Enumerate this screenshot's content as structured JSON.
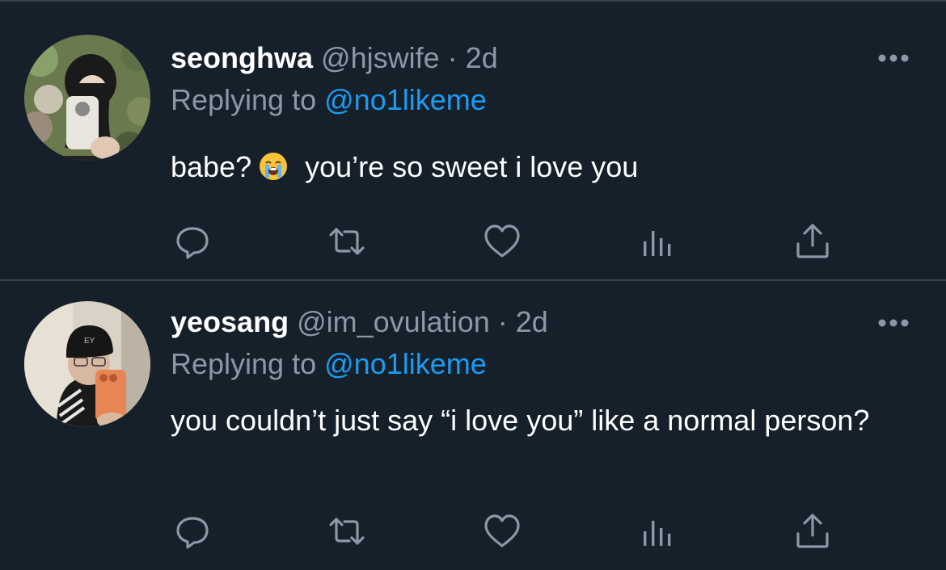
{
  "tweets": [
    {
      "display_name": "seonghwa",
      "handle": "@hjswife",
      "separator": "·",
      "time": "2d",
      "replying_prefix": "Replying to",
      "replying_to": "@no1likeme",
      "text_before_emoji": "babe?",
      "emoji": "loudly-crying-face",
      "text_after_emoji": "you’re so sweet i love you"
    },
    {
      "display_name": "yeosang",
      "handle": "@im_ovulation",
      "separator": "·",
      "time": "2d",
      "replying_prefix": "Replying to",
      "replying_to": "@no1likeme",
      "text": "you couldn’t just say “i love you” like a normal person?"
    }
  ],
  "action_icons": [
    "reply-icon",
    "retweet-icon",
    "like-icon",
    "views-icon",
    "share-icon"
  ],
  "colors": {
    "background": "#15202b",
    "divider": "#38444d",
    "muted_text": "#8b98a5",
    "accent_link": "#1d9bf0",
    "primary_text": "#ffffff"
  }
}
